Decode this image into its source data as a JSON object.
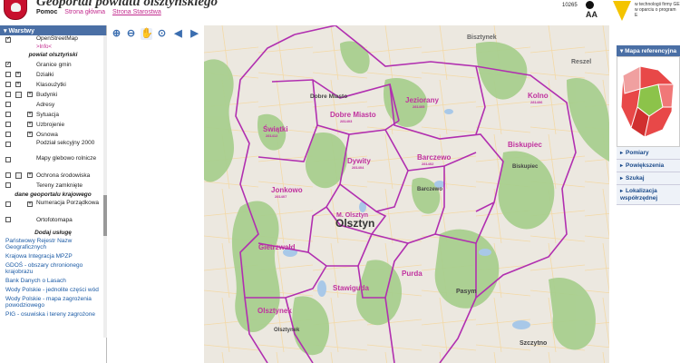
{
  "header": {
    "title": "Geoportal powiatu olsztyńskiego",
    "links": [
      "Pomoc",
      "Strona główna",
      "Strona Starostwa"
    ],
    "counter": "10265",
    "font_size_label": "AA",
    "credit_line1": "w technologii firmy GE",
    "credit_line2": "w oparciu o program E"
  },
  "toolbar": {
    "icons": [
      "zoom-in-icon",
      "zoom-out-icon",
      "pan-hand-icon",
      "zoom-box-icon",
      "back-arrow-icon",
      "forward-arrow-icon",
      "link-icon",
      "measure-icon",
      "info-icon",
      "search-icon",
      "scale-icon",
      "print-icon",
      "globe-icon"
    ]
  },
  "layers": {
    "header": "Warstwy",
    "items": [
      {
        "label": "OpenStreetMap",
        "info": ">Info<",
        "checked": true
      },
      {
        "label": "powiat olsztyński",
        "group": true
      },
      {
        "label": "Granice gmin",
        "checked": true
      },
      {
        "label": "Działki",
        "checked": false
      },
      {
        "label": "Klasoużytki",
        "checked": false
      },
      {
        "label": "Budynki",
        "checked": false
      },
      {
        "label": "Adresy",
        "checked": false
      },
      {
        "label": "Sytuacja",
        "checked": false
      },
      {
        "label": "Uzbrojenie",
        "checked": false
      },
      {
        "label": "Osnowa",
        "checked": false
      },
      {
        "label": "Podział sekcyjny 2000",
        "checked": false
      },
      {
        "label": "Mapy glebowo rolnicze",
        "checked": false
      },
      {
        "label": "Ochrona środowiska",
        "checked": false
      },
      {
        "label": "Tereny zamknięte",
        "checked": false
      },
      {
        "label": "dane geoportalu krajowego",
        "group": true
      },
      {
        "label": "Numeracja Porządkowa",
        "checked": false
      },
      {
        "label": "Ortofotomapa",
        "checked": false
      }
    ],
    "add_service": "Dodaj usługę",
    "services": [
      "Państwowy Rejestr Nazw Geograficznych",
      "Krajowa Integracja MPZP",
      "GDOŚ - obszary chronionego krajobrazu",
      "Bank Danych o Lasach",
      "Wody Polskie - jednolite części wód",
      "Wody Polskie - mapa zagrożenia powodziowego",
      "PIG - osuwiska i tereny zagrożone"
    ]
  },
  "map": {
    "places": [
      {
        "name": "Bisztynek",
        "code": "",
        "kind": "town"
      },
      {
        "name": "Reszel",
        "code": "",
        "kind": "town"
      },
      {
        "name": "Dobre Miasto",
        "code": "",
        "kind": "town"
      },
      {
        "name": "Jeziorany",
        "code": "281405",
        "kind": "gmina"
      },
      {
        "name": "Kolno",
        "code": "281406",
        "kind": "gmina"
      },
      {
        "name": "Świątki",
        "code": "281412",
        "kind": "gmina"
      },
      {
        "name": "Dobre Miasto",
        "code": "281403",
        "kind": "gmina"
      },
      {
        "name": "Biskupiec",
        "code": "",
        "kind": "gmina"
      },
      {
        "name": "Dywity",
        "code": "281404",
        "kind": "gmina"
      },
      {
        "name": "Barczewo",
        "code": "281402",
        "kind": "gmina"
      },
      {
        "name": "Biskupiec",
        "code": "",
        "kind": "town"
      },
      {
        "name": "Barczewo",
        "code": "",
        "kind": "town"
      },
      {
        "name": "Jonkowo",
        "code": "281407",
        "kind": "gmina"
      },
      {
        "name": "M. Olsztyn",
        "code": "",
        "kind": "gmina"
      },
      {
        "name": "Olsztyn",
        "code": "",
        "kind": "city"
      },
      {
        "name": "Gietrzwałd",
        "code": "",
        "kind": "gmina"
      },
      {
        "name": "Purda",
        "code": "",
        "kind": "gmina"
      },
      {
        "name": "Stawiguda",
        "code": "",
        "kind": "gmina"
      },
      {
        "name": "Olsztynek",
        "code": "",
        "kind": "gmina"
      },
      {
        "name": "Olsztynek",
        "code": "",
        "kind": "town"
      },
      {
        "name": "Pasym",
        "code": "",
        "kind": "town"
      },
      {
        "name": "Szczytno",
        "code": "",
        "kind": "town"
      }
    ],
    "boundary_color": "#b12fb0",
    "label_color": "#c0329f"
  },
  "right_panel": {
    "header": "Mapa referencyjna",
    "items": [
      "Pomiary",
      "Powiększenia",
      "Szukaj",
      "Lokalizacja współrzędnej"
    ]
  }
}
